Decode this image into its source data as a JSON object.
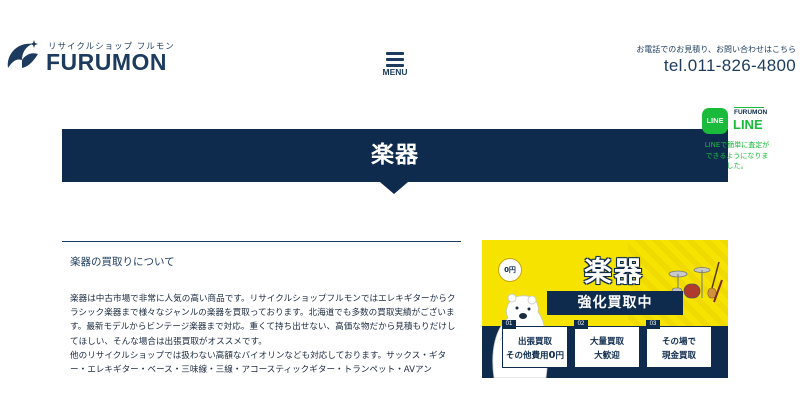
{
  "header": {
    "logo_kana": "リサイクルショップ フルモン",
    "logo_word": "FURUMON",
    "menu_label": "MENU",
    "contact_note": "お電話でのお見積り、お問い合わせはこちら",
    "phone": "tel.011-826-4800"
  },
  "line_badge": {
    "icon_text": "LINE",
    "brand_small": "FURUMON",
    "brand_big": "LINE",
    "description": "LINEで簡単に査定ができるようになりました。"
  },
  "page": {
    "title": "楽器"
  },
  "section": {
    "heading": "楽器の買取りについて",
    "paragraph1": "楽器は中古市場で非常に人気の高い商品です。リサイクルショップフルモンではエレキギターからクラシック楽器まで様々なジャンルの楽器を買取っております。北海道でも多数の買取実績がございます。最新モデルからビンテージ楽器まで対応。重くて持ち出せない、高価な物だから見積もりだけしてほしい、そんな場合は出張買取がオススメです。",
    "paragraph2": "他のリサイクルショップでは扱わない高額なバイオリンなども対応しております。サックス・ギター・エレキギター・ベース・三味線・三線・アコースティックギター・トランペット・AVアン"
  },
  "banner": {
    "title": "楽器",
    "subtitle": "強化買取中",
    "yen_text": "0円",
    "features": [
      {
        "num": "01",
        "line1": "出張買取",
        "line2_prefix": "その他費用",
        "line2_emph": "0",
        "line2_suffix": "円"
      },
      {
        "num": "02",
        "line1": "大量買取",
        "line2_prefix": "大歓迎",
        "line2_emph": "",
        "line2_suffix": ""
      },
      {
        "num": "03",
        "line1": "その場で",
        "line2_prefix": "現金買取",
        "line2_emph": "",
        "line2_suffix": ""
      }
    ]
  },
  "colors": {
    "navy": "#0e2b4d",
    "line_green": "#1aba3b",
    "banner_yellow": "#f6e400"
  }
}
